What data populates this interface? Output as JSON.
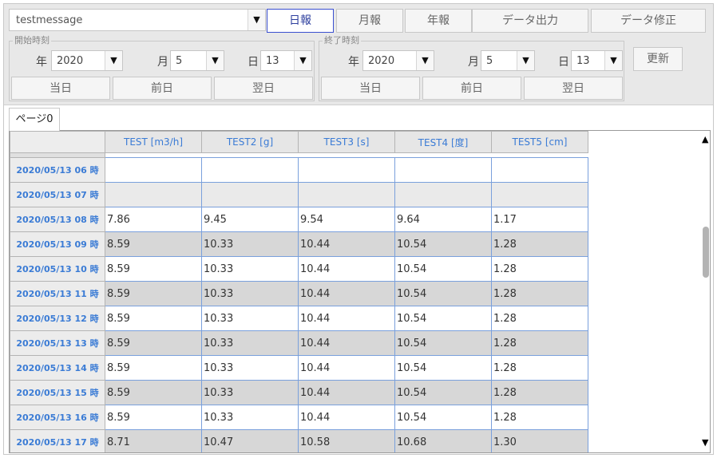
{
  "message_select": {
    "value": "testmessage"
  },
  "report_buttons": [
    {
      "label": "日報",
      "active": true
    },
    {
      "label": "月報"
    },
    {
      "label": "年報"
    },
    {
      "label": "データ出力"
    },
    {
      "label": "データ修正"
    }
  ],
  "start": {
    "legend": "開始時刻",
    "year_label": "年",
    "year": "2020",
    "month_label": "月",
    "month": "5",
    "day_label": "日",
    "day": "13",
    "buttons": [
      "当日",
      "前日",
      "翌日"
    ]
  },
  "end": {
    "legend": "終了時刻",
    "year_label": "年",
    "year": "2020",
    "month_label": "月",
    "month": "5",
    "day_label": "日",
    "day": "13",
    "buttons": [
      "当日",
      "前日",
      "翌日"
    ]
  },
  "update_button": "更新",
  "page_tab": "ページ0",
  "dropdown_arrow": "▼",
  "scroll_up": "▲",
  "scroll_down": "▼",
  "columns": [
    "TEST [m3/h]",
    "TEST2 [g]",
    "TEST3 [s]",
    "TEST4 [度]",
    "TEST5 [cm]"
  ],
  "rows": [
    {
      "time": "2020/05/13 06 時",
      "values": [
        "",
        "",
        "",
        "",
        ""
      ]
    },
    {
      "time": "2020/05/13 07 時",
      "values": [
        "",
        "",
        "",
        "",
        ""
      ]
    },
    {
      "time": "2020/05/13 08 時",
      "values": [
        "7.86",
        "9.45",
        "9.54",
        "9.64",
        "1.17"
      ]
    },
    {
      "time": "2020/05/13 09 時",
      "values": [
        "8.59",
        "10.33",
        "10.44",
        "10.54",
        "1.28"
      ]
    },
    {
      "time": "2020/05/13 10 時",
      "values": [
        "8.59",
        "10.33",
        "10.44",
        "10.54",
        "1.28"
      ]
    },
    {
      "time": "2020/05/13 11 時",
      "values": [
        "8.59",
        "10.33",
        "10.44",
        "10.54",
        "1.28"
      ]
    },
    {
      "time": "2020/05/13 12 時",
      "values": [
        "8.59",
        "10.33",
        "10.44",
        "10.54",
        "1.28"
      ]
    },
    {
      "time": "2020/05/13 13 時",
      "values": [
        "8.59",
        "10.33",
        "10.44",
        "10.54",
        "1.28"
      ]
    },
    {
      "time": "2020/05/13 14 時",
      "values": [
        "8.59",
        "10.33",
        "10.44",
        "10.54",
        "1.28"
      ]
    },
    {
      "time": "2020/05/13 15 時",
      "values": [
        "8.59",
        "10.33",
        "10.44",
        "10.54",
        "1.28"
      ]
    },
    {
      "time": "2020/05/13 16 時",
      "values": [
        "8.59",
        "10.33",
        "10.44",
        "10.54",
        "1.28"
      ]
    },
    {
      "time": "2020/05/13 17 時",
      "values": [
        "8.71",
        "10.47",
        "10.58",
        "10.68",
        "1.30"
      ]
    }
  ],
  "colors": {
    "header_text": "#3a7bd5",
    "active_border": "#3a4fd0",
    "cell_border": "#7aa0dc"
  }
}
